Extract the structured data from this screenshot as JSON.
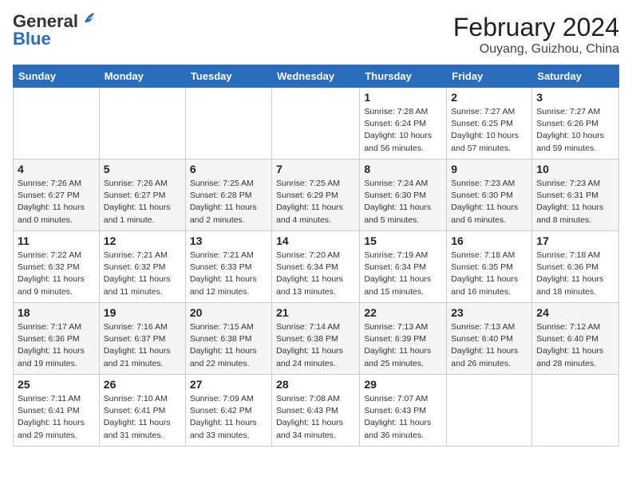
{
  "header": {
    "logo_general": "General",
    "logo_blue": "Blue",
    "month_title": "February 2024",
    "location": "Ouyang, Guizhou, China"
  },
  "days_of_week": [
    "Sunday",
    "Monday",
    "Tuesday",
    "Wednesday",
    "Thursday",
    "Friday",
    "Saturday"
  ],
  "weeks": [
    [
      {
        "day": "",
        "info": ""
      },
      {
        "day": "",
        "info": ""
      },
      {
        "day": "",
        "info": ""
      },
      {
        "day": "",
        "info": ""
      },
      {
        "day": "1",
        "info": "Sunrise: 7:28 AM\nSunset: 6:24 PM\nDaylight: 10 hours\nand 56 minutes."
      },
      {
        "day": "2",
        "info": "Sunrise: 7:27 AM\nSunset: 6:25 PM\nDaylight: 10 hours\nand 57 minutes."
      },
      {
        "day": "3",
        "info": "Sunrise: 7:27 AM\nSunset: 6:26 PM\nDaylight: 10 hours\nand 59 minutes."
      }
    ],
    [
      {
        "day": "4",
        "info": "Sunrise: 7:26 AM\nSunset: 6:27 PM\nDaylight: 11 hours\nand 0 minutes."
      },
      {
        "day": "5",
        "info": "Sunrise: 7:26 AM\nSunset: 6:27 PM\nDaylight: 11 hours\nand 1 minute."
      },
      {
        "day": "6",
        "info": "Sunrise: 7:25 AM\nSunset: 6:28 PM\nDaylight: 11 hours\nand 2 minutes."
      },
      {
        "day": "7",
        "info": "Sunrise: 7:25 AM\nSunset: 6:29 PM\nDaylight: 11 hours\nand 4 minutes."
      },
      {
        "day": "8",
        "info": "Sunrise: 7:24 AM\nSunset: 6:30 PM\nDaylight: 11 hours\nand 5 minutes."
      },
      {
        "day": "9",
        "info": "Sunrise: 7:23 AM\nSunset: 6:30 PM\nDaylight: 11 hours\nand 6 minutes."
      },
      {
        "day": "10",
        "info": "Sunrise: 7:23 AM\nSunset: 6:31 PM\nDaylight: 11 hours\nand 8 minutes."
      }
    ],
    [
      {
        "day": "11",
        "info": "Sunrise: 7:22 AM\nSunset: 6:32 PM\nDaylight: 11 hours\nand 9 minutes."
      },
      {
        "day": "12",
        "info": "Sunrise: 7:21 AM\nSunset: 6:32 PM\nDaylight: 11 hours\nand 11 minutes."
      },
      {
        "day": "13",
        "info": "Sunrise: 7:21 AM\nSunset: 6:33 PM\nDaylight: 11 hours\nand 12 minutes."
      },
      {
        "day": "14",
        "info": "Sunrise: 7:20 AM\nSunset: 6:34 PM\nDaylight: 11 hours\nand 13 minutes."
      },
      {
        "day": "15",
        "info": "Sunrise: 7:19 AM\nSunset: 6:34 PM\nDaylight: 11 hours\nand 15 minutes."
      },
      {
        "day": "16",
        "info": "Sunrise: 7:18 AM\nSunset: 6:35 PM\nDaylight: 11 hours\nand 16 minutes."
      },
      {
        "day": "17",
        "info": "Sunrise: 7:18 AM\nSunset: 6:36 PM\nDaylight: 11 hours\nand 18 minutes."
      }
    ],
    [
      {
        "day": "18",
        "info": "Sunrise: 7:17 AM\nSunset: 6:36 PM\nDaylight: 11 hours\nand 19 minutes."
      },
      {
        "day": "19",
        "info": "Sunrise: 7:16 AM\nSunset: 6:37 PM\nDaylight: 11 hours\nand 21 minutes."
      },
      {
        "day": "20",
        "info": "Sunrise: 7:15 AM\nSunset: 6:38 PM\nDaylight: 11 hours\nand 22 minutes."
      },
      {
        "day": "21",
        "info": "Sunrise: 7:14 AM\nSunset: 6:38 PM\nDaylight: 11 hours\nand 24 minutes."
      },
      {
        "day": "22",
        "info": "Sunrise: 7:13 AM\nSunset: 6:39 PM\nDaylight: 11 hours\nand 25 minutes."
      },
      {
        "day": "23",
        "info": "Sunrise: 7:13 AM\nSunset: 6:40 PM\nDaylight: 11 hours\nand 26 minutes."
      },
      {
        "day": "24",
        "info": "Sunrise: 7:12 AM\nSunset: 6:40 PM\nDaylight: 11 hours\nand 28 minutes."
      }
    ],
    [
      {
        "day": "25",
        "info": "Sunrise: 7:11 AM\nSunset: 6:41 PM\nDaylight: 11 hours\nand 29 minutes."
      },
      {
        "day": "26",
        "info": "Sunrise: 7:10 AM\nSunset: 6:41 PM\nDaylight: 11 hours\nand 31 minutes."
      },
      {
        "day": "27",
        "info": "Sunrise: 7:09 AM\nSunset: 6:42 PM\nDaylight: 11 hours\nand 33 minutes."
      },
      {
        "day": "28",
        "info": "Sunrise: 7:08 AM\nSunset: 6:43 PM\nDaylight: 11 hours\nand 34 minutes."
      },
      {
        "day": "29",
        "info": "Sunrise: 7:07 AM\nSunset: 6:43 PM\nDaylight: 11 hours\nand 36 minutes."
      },
      {
        "day": "",
        "info": ""
      },
      {
        "day": "",
        "info": ""
      }
    ]
  ]
}
